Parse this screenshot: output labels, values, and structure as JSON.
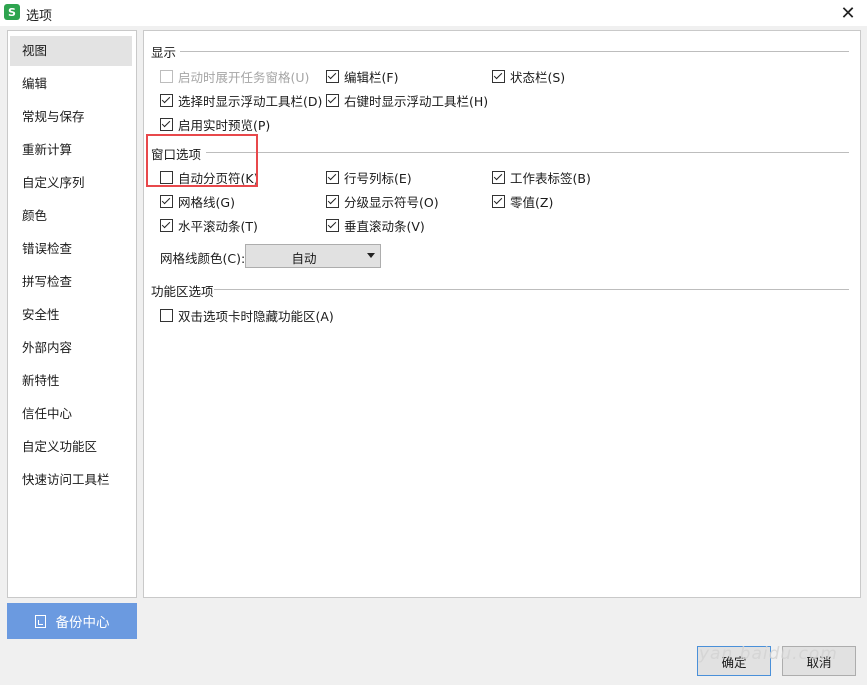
{
  "window": {
    "title": "选项",
    "app_icon_letter": "S",
    "close_icon": "close-icon"
  },
  "sidebar": {
    "items": [
      {
        "label": "视图"
      },
      {
        "label": "编辑"
      },
      {
        "label": "常规与保存"
      },
      {
        "label": "重新计算"
      },
      {
        "label": "自定义序列"
      },
      {
        "label": "颜色"
      },
      {
        "label": "错误检查"
      },
      {
        "label": "拼写检查"
      },
      {
        "label": "安全性"
      },
      {
        "label": "外部内容"
      },
      {
        "label": "新特性"
      },
      {
        "label": "信任中心"
      },
      {
        "label": "自定义功能区"
      },
      {
        "label": "快速访问工具栏"
      }
    ],
    "active_index": 0
  },
  "backup": {
    "label": "备份中心",
    "icon": "backup-icon",
    "color": "#6b9ae0"
  },
  "display": {
    "title": "显示",
    "options": [
      {
        "label": "启动时展开任务窗格(U)",
        "checked": false,
        "disabled": true
      },
      {
        "label": "编辑栏(F)",
        "checked": true
      },
      {
        "label": "状态栏(S)",
        "checked": true
      },
      {
        "label": "选择时显示浮动工具栏(D)",
        "checked": true
      },
      {
        "label": "右键时显示浮动工具栏(H)",
        "checked": true
      },
      {
        "label": "启用实时预览(P)",
        "checked": true
      }
    ]
  },
  "window_options": {
    "title": "窗口选项",
    "options": [
      {
        "label": "自动分页符(K)",
        "checked": false
      },
      {
        "label": "行号列标(E)",
        "checked": true
      },
      {
        "label": "工作表标签(B)",
        "checked": true
      },
      {
        "label": "网格线(G)",
        "checked": true
      },
      {
        "label": "分级显示符号(O)",
        "checked": true
      },
      {
        "label": "零值(Z)",
        "checked": true
      },
      {
        "label": "水平滚动条(T)",
        "checked": true
      },
      {
        "label": "垂直滚动条(V)",
        "checked": true
      }
    ],
    "grid_color_label": "网格线颜色(C):",
    "grid_color_value": "自动",
    "highlight_color": "#e8484b"
  },
  "ribbon": {
    "title": "功能区选项",
    "options": [
      {
        "label": "双击选项卡时隐藏功能区(A)",
        "checked": false
      }
    ]
  },
  "footer": {
    "ok_label": "确定",
    "cancel_label": "取消"
  },
  "watermark": "yan baidu.com"
}
